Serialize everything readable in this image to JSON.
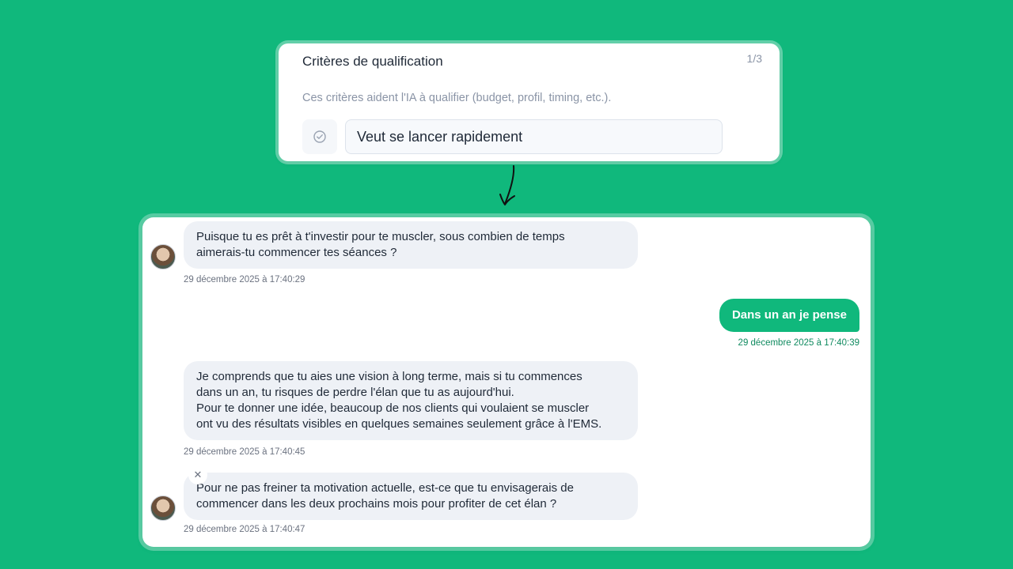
{
  "criteria": {
    "title": "Critères de qualification",
    "step": "1/3",
    "description": "Ces critères aident l'IA à qualifier (budget, profil, timing, etc.).",
    "input_value": "Veut se lancer rapidement"
  },
  "chat": {
    "messages": [
      {
        "from": "assistant",
        "lines": [
          "Puisque tu es prêt à t'investir pour te muscler, sous combien de temps",
          "aimerais-tu commencer tes séances ?"
        ],
        "timestamp": "29 décembre 2025 à 17:40:29"
      },
      {
        "from": "user",
        "text": "Dans un an je pense",
        "timestamp": "29 décembre 2025 à 17:40:39"
      },
      {
        "from": "assistant",
        "lines": [
          "Je comprends que tu aies une vision à long terme, mais si tu commences",
          "dans un an, tu risques de perdre l'élan que tu as aujourd'hui.",
          "Pour te donner une idée, beaucoup de nos clients qui voulaient se muscler",
          "ont vu des résultats visibles en quelques semaines seulement grâce à l'EMS."
        ],
        "timestamp": "29 décembre 2025 à 17:40:45"
      },
      {
        "from": "assistant",
        "lines": [
          "Pour ne pas freiner ta motivation actuelle, est-ce que tu envisagerais de",
          "commencer dans les deux prochains mois pour profiter de cet élan ?"
        ],
        "timestamp": "29 décembre 2025 à 17:40:47"
      }
    ]
  },
  "colors": {
    "accent": "#10b87c",
    "bubble_in": "#eef1f6"
  }
}
